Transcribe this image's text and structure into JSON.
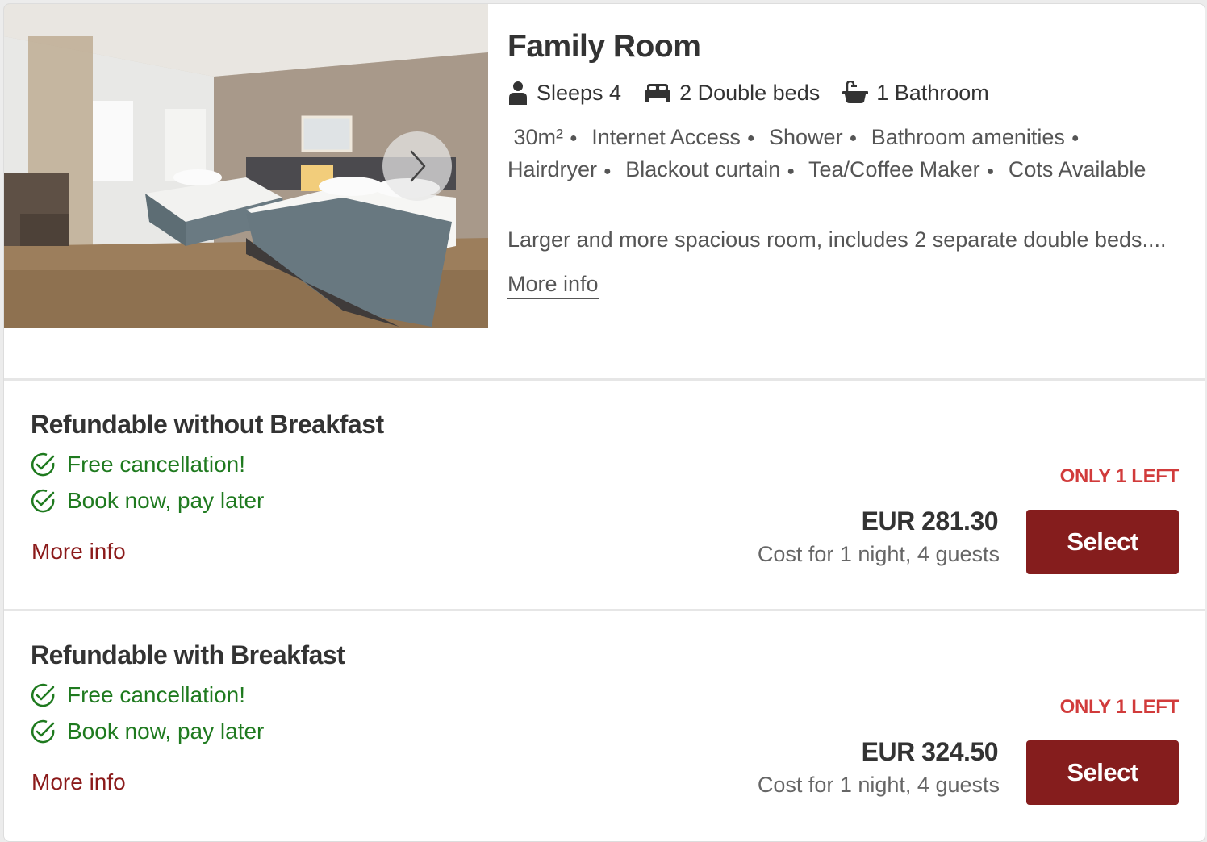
{
  "room": {
    "title": "Family Room",
    "features": [
      {
        "icon": "person-icon",
        "label": "Sleeps 4"
      },
      {
        "icon": "bed-icon",
        "label": "2 Double beds"
      },
      {
        "icon": "bathtub-icon",
        "label": "1 Bathroom"
      }
    ],
    "size": "30m²",
    "amenities": [
      "Internet Access",
      "Shower",
      "Bathroom amenities",
      "Hairdryer",
      "Blackout curtain",
      "Tea/Coffee Maker",
      "Cots Available"
    ],
    "description": "Larger and more spacious room, includes 2 separate double beds....",
    "more_info": "More info"
  },
  "rates": [
    {
      "title": "Refundable without Breakfast",
      "perks": [
        "Free cancellation!",
        "Book now, pay later"
      ],
      "more_info": "More info",
      "availability": "ONLY 1 LEFT",
      "price": "EUR 281.30",
      "cost_note": "Cost for 1 night, 4 guests",
      "select_label": "Select"
    },
    {
      "title": "Refundable with Breakfast",
      "perks": [
        "Free cancellation!",
        "Book now, pay later"
      ],
      "more_info": "More info",
      "availability": "ONLY 1 LEFT",
      "price": "EUR 324.50",
      "cost_note": "Cost for 1 night, 4 guests",
      "select_label": "Select"
    }
  ],
  "colors": {
    "accent": "#851d1d",
    "success": "#1f7a1f",
    "warning": "#d13b3b"
  }
}
